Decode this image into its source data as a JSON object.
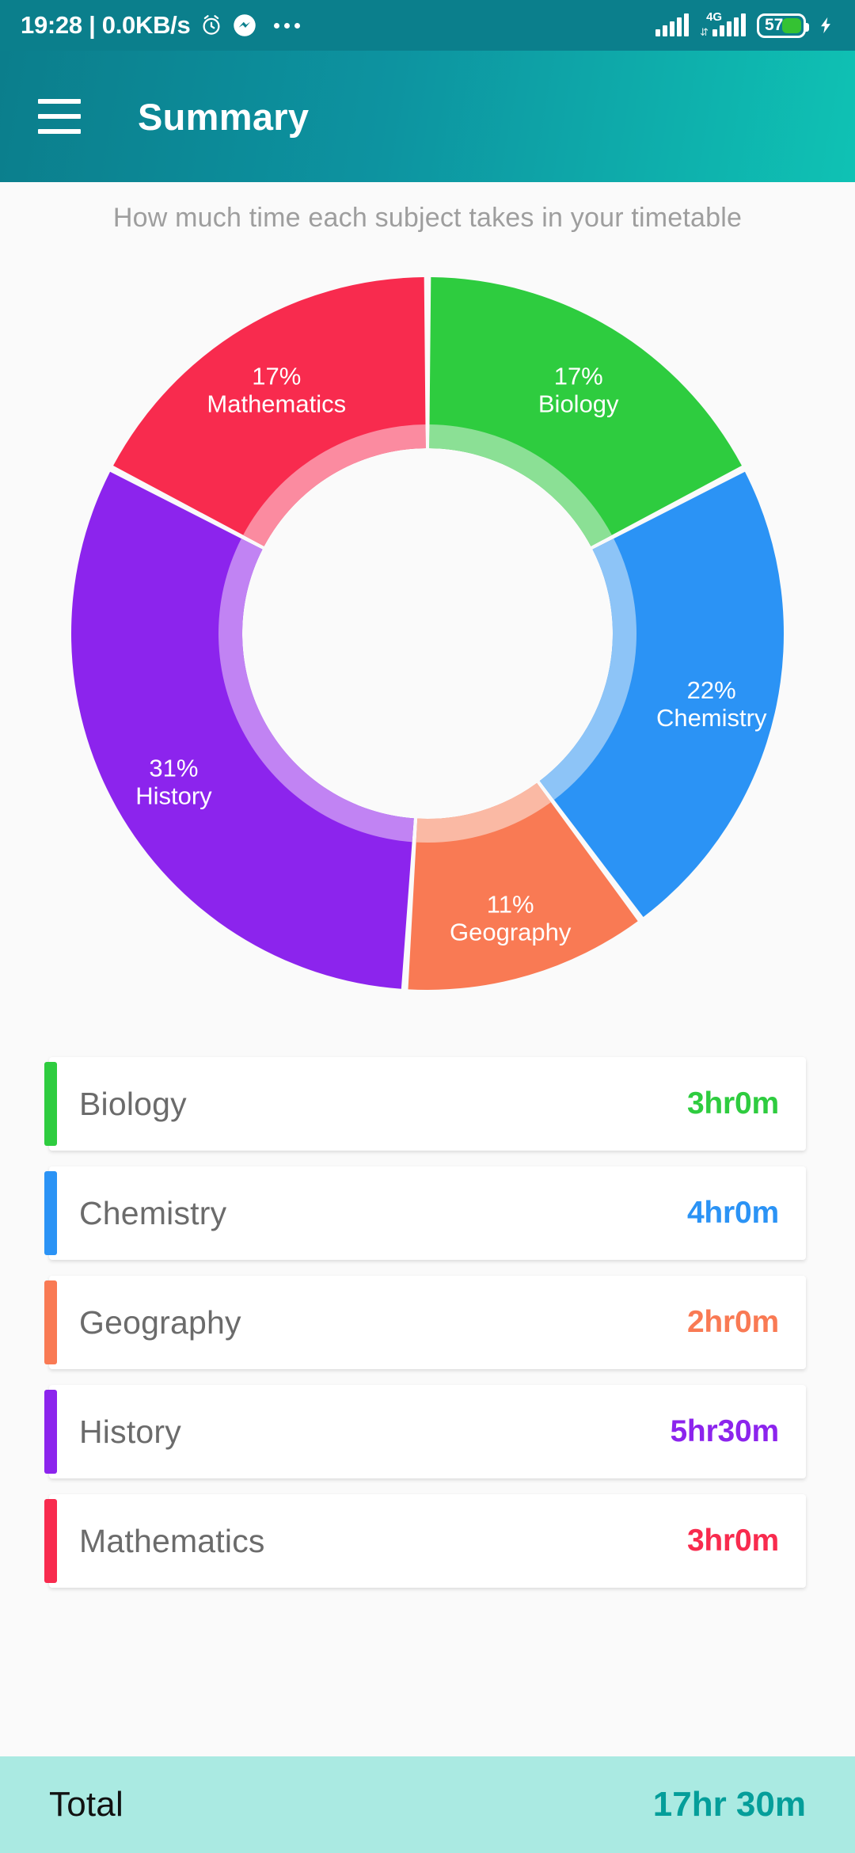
{
  "status_bar": {
    "clock": "19:28 | 0.0KB/s",
    "alarm_icon": "alarm-clock-icon",
    "messenger_icon": "messenger-icon",
    "overflow_icon": "more-notifications-icon",
    "signal_icon": "signal-bars-icon",
    "network_label": "4G",
    "battery_percent": "57",
    "charging_icon": "charging-bolt-icon"
  },
  "app_bar": {
    "menu_icon": "hamburger-menu-icon",
    "title": "Summary",
    "gradient_start": "#0b7e8c",
    "gradient_end": "#0fc2b4"
  },
  "subtitle": "How much time each subject takes in your timetable",
  "chart_data": {
    "type": "pie",
    "title": "",
    "subtitle": "How much time each subject takes in your timetable",
    "categories": [
      "Biology",
      "Chemistry",
      "Geography",
      "History",
      "Mathematics"
    ],
    "values": [
      17,
      22,
      11,
      31,
      17
    ],
    "unit": "%",
    "hours": [
      3,
      4,
      2,
      5.5,
      3
    ],
    "colors": [
      "#2ecc3f",
      "#2b93f5",
      "#f97a54",
      "#8c24ed",
      "#f82b4e"
    ],
    "inner_colors": [
      "#8be095",
      "#8dc4f7",
      "#fab9a4",
      "#c183f3",
      "#fb8ba0"
    ],
    "legend": "none",
    "labels": [
      {
        "percent": "17%",
        "name": "Biology"
      },
      {
        "percent": "22%",
        "name": "Chemistry"
      },
      {
        "percent": "11%",
        "name": "Geography"
      },
      {
        "percent": "31%",
        "name": "History"
      },
      {
        "percent": "17%",
        "name": "Mathematics"
      }
    ],
    "start_angle": 0,
    "direction": "clockwise",
    "donut_hole_ratio": 0.52
  },
  "subjects": [
    {
      "name": "Biology",
      "time": "3hr0m",
      "color": "#2ecc3f"
    },
    {
      "name": "Chemistry",
      "time": "4hr0m",
      "color": "#2b93f5"
    },
    {
      "name": "Geography",
      "time": "2hr0m",
      "color": "#f97a54"
    },
    {
      "name": "History",
      "time": "5hr30m",
      "color": "#8c24ed"
    },
    {
      "name": "Mathematics",
      "time": "3hr0m",
      "color": "#f82b4e"
    }
  ],
  "total": {
    "label": "Total",
    "value": "17hr 30m",
    "background": "#aaeae2",
    "value_color": "#049e9a"
  }
}
